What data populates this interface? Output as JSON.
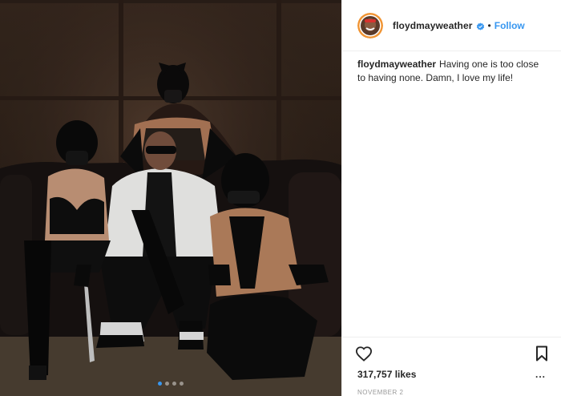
{
  "post": {
    "username": "floydmayweather",
    "separator": "•",
    "follow_label": "Follow",
    "caption_text": "Having one is too close to having none. Damn, I love my life!",
    "likes": "317,757 likes",
    "more_label": "...",
    "date": "NOVEMBER 2",
    "carousel": {
      "total": 4,
      "active_index": 0
    }
  },
  "icons": {
    "verified": "verified-badge-icon",
    "like": "heart-icon",
    "save": "bookmark-icon"
  },
  "colors": {
    "accent": "#3897f0",
    "text": "#262626",
    "muted": "#999999",
    "border": "#efefef"
  }
}
